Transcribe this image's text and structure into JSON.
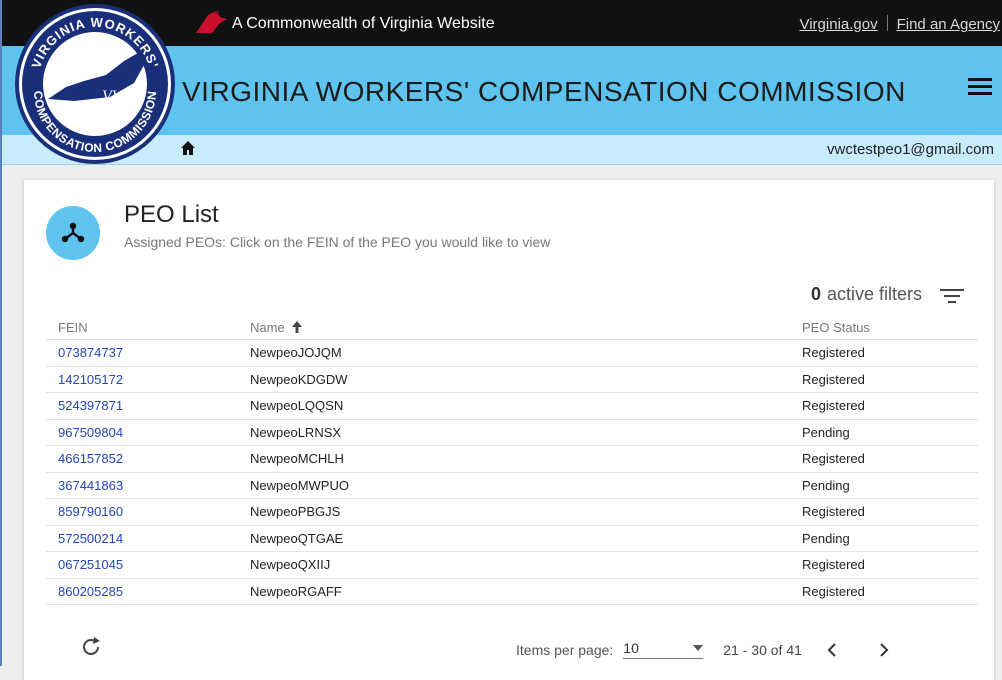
{
  "topbar": {
    "commonwealth_text": "A Commonwealth of Virginia Website",
    "links": [
      "Virginia.gov",
      "Find an Agency"
    ]
  },
  "header": {
    "title": "VIRGINIA WORKERS' COMPENSATION COMMISSION",
    "seal_top": "VIRGINIA WORKERS'",
    "seal_bottom": "COMPENSATION COMMISSION",
    "seal_mark": "VWC"
  },
  "subbar": {
    "user_email": "vwctestpeo1@gmail.com"
  },
  "page": {
    "title": "PEO List",
    "subtitle": "Assigned PEOs: Click on the FEIN of the PEO you would like to view",
    "filters_count": "0",
    "filters_label": "active filters"
  },
  "table": {
    "columns": [
      "FEIN",
      "Name",
      "PEO Status"
    ],
    "rows": [
      {
        "fein": "073874737",
        "name": "NewpeoJOJQM",
        "status": "Registered"
      },
      {
        "fein": "142105172",
        "name": "NewpeoKDGDW",
        "status": "Registered"
      },
      {
        "fein": "524397871",
        "name": "NewpeoLQQSN",
        "status": "Registered"
      },
      {
        "fein": "967509804",
        "name": "NewpeoLRNSX",
        "status": "Pending"
      },
      {
        "fein": "466157852",
        "name": "NewpeoMCHLH",
        "status": "Registered"
      },
      {
        "fein": "367441863",
        "name": "NewpeoMWPUO",
        "status": "Pending"
      },
      {
        "fein": "859790160",
        "name": "NewpeoPBGJS",
        "status": "Registered"
      },
      {
        "fein": "572500214",
        "name": "NewpeoQTGAE",
        "status": "Pending"
      },
      {
        "fein": "067251045",
        "name": "NewpeoQXIIJ",
        "status": "Registered"
      },
      {
        "fein": "860205285",
        "name": "NewpeoRGAFF",
        "status": "Registered"
      }
    ]
  },
  "pagination": {
    "items_per_page_label": "Items per page:",
    "items_per_page_value": "10",
    "range_label": "21 - 30 of 41"
  },
  "colors": {
    "header": "#5ec3ee",
    "subbar": "#c7ecfb",
    "link": "#2345b8",
    "topbar": "#111111"
  }
}
